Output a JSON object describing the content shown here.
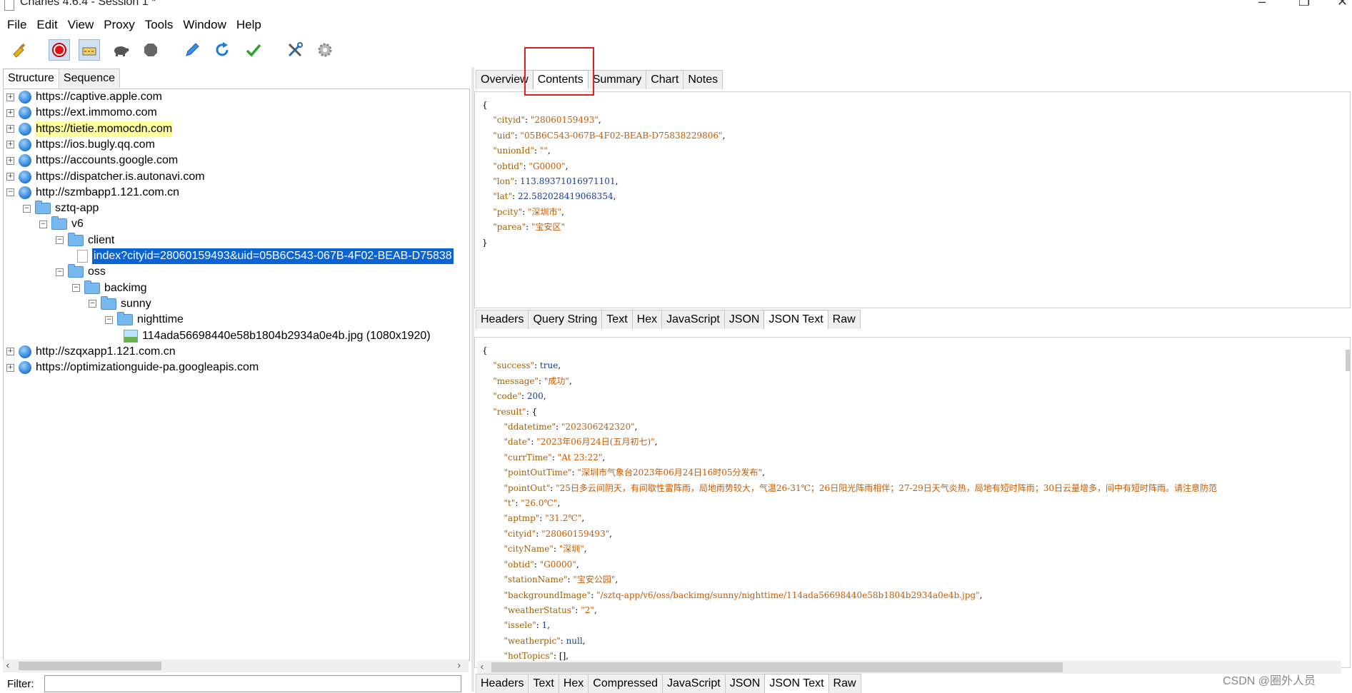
{
  "window": {
    "title": "Charles 4.6.4 - Session 1 *",
    "controls": [
      "–",
      "❐",
      "✕"
    ]
  },
  "menu": [
    "File",
    "Edit",
    "View",
    "Proxy",
    "Tools",
    "Window",
    "Help"
  ],
  "toolbar": {
    "icons": [
      "broom-icon",
      "record-icon",
      "throttle-icon",
      "turtle-icon",
      "stop-icon",
      "pen-icon",
      "refresh-icon",
      "check-icon",
      "tools-icon",
      "settings-icon"
    ]
  },
  "left": {
    "tabs": [
      "Structure",
      "Sequence"
    ],
    "active_tab": "Structure",
    "tree": [
      {
        "label": "https://captive.apple.com",
        "expander": "+"
      },
      {
        "label": "https://ext.immomo.com",
        "expander": "+"
      },
      {
        "label": "https://tietie.momocdn.com",
        "expander": "+"
      },
      {
        "label": "https://ios.bugly.qq.com",
        "expander": "+"
      },
      {
        "label": "https://accounts.google.com",
        "expander": "+"
      },
      {
        "label": "https://dispatcher.is.autonavi.com",
        "expander": "+"
      },
      {
        "label": "http://szmbapp1.121.com.cn",
        "expander": "−"
      },
      {
        "label": "sztq-app",
        "expander": "−"
      },
      {
        "label": "v6",
        "expander": "−"
      },
      {
        "label": "client",
        "expander": "−"
      },
      {
        "label": "index?cityid=28060159493&uid=05B6C543-067B-4F02-BEAB-D75838"
      },
      {
        "label": "oss",
        "expander": "−"
      },
      {
        "label": "backimg",
        "expander": "−"
      },
      {
        "label": "sunny",
        "expander": "−"
      },
      {
        "label": "nighttime",
        "expander": "−"
      },
      {
        "label": "114ada56698440e58b1804b2934a0e4b.jpg (1080x1920)"
      },
      {
        "label": "http://szqxapp1.121.com.cn",
        "expander": "+"
      },
      {
        "label": "https://optimizationguide-pa.googleapis.com",
        "expander": "+"
      }
    ],
    "filter_label": "Filter:",
    "filter_value": ""
  },
  "right": {
    "top_tabs": [
      "Overview",
      "Contents",
      "Summary",
      "Chart",
      "Notes"
    ],
    "active_top_tab": "Contents",
    "request_tabs": [
      "Headers",
      "Query String",
      "Text",
      "Hex",
      "JavaScript",
      "JSON",
      "JSON Text",
      "Raw"
    ],
    "active_request_tab": "JSON Text",
    "response_tabs": [
      "Headers",
      "Text",
      "Hex",
      "Compressed",
      "JavaScript",
      "JSON",
      "JSON Text",
      "Raw"
    ],
    "active_response_tab": "JSON Text",
    "request_lines": [
      [
        [
          "p",
          "{"
        ]
      ],
      [
        [
          "p",
          "    "
        ],
        [
          "k",
          "\"cityid\""
        ],
        [
          "p",
          ": "
        ],
        [
          "s",
          "\"28060159493\""
        ],
        [
          "p",
          ","
        ]
      ],
      [
        [
          "p",
          "    "
        ],
        [
          "k",
          "\"uid\""
        ],
        [
          "p",
          ": "
        ],
        [
          "s",
          "\"05B6C543-067B-4F02-BEAB-D75838229806\""
        ],
        [
          "p",
          ","
        ]
      ],
      [
        [
          "p",
          "    "
        ],
        [
          "k",
          "\"unionId\""
        ],
        [
          "p",
          ": "
        ],
        [
          "s",
          "\"\""
        ],
        [
          "p",
          ","
        ]
      ],
      [
        [
          "p",
          "    "
        ],
        [
          "k",
          "\"obtid\""
        ],
        [
          "p",
          ": "
        ],
        [
          "s",
          "\"G0000\""
        ],
        [
          "p",
          ","
        ]
      ],
      [
        [
          "p",
          "    "
        ],
        [
          "k",
          "\"lon\""
        ],
        [
          "p",
          ": "
        ],
        [
          "n",
          "113.89371016971101"
        ],
        [
          "p",
          ","
        ]
      ],
      [
        [
          "p",
          "    "
        ],
        [
          "k",
          "\"lat\""
        ],
        [
          "p",
          ": "
        ],
        [
          "n",
          "22.582028419068354"
        ],
        [
          "p",
          ","
        ]
      ],
      [
        [
          "p",
          "    "
        ],
        [
          "k",
          "\"pcity\""
        ],
        [
          "p",
          ": "
        ],
        [
          "s",
          "\"深圳市\""
        ],
        [
          "p",
          ","
        ]
      ],
      [
        [
          "p",
          "    "
        ],
        [
          "k",
          "\"parea\""
        ],
        [
          "p",
          ": "
        ],
        [
          "s",
          "\"宝安区\""
        ]
      ],
      [
        [
          "p",
          "}"
        ]
      ]
    ],
    "response_lines": [
      [
        [
          "p",
          "{"
        ]
      ],
      [
        [
          "p",
          "    "
        ],
        [
          "k",
          "\"success\""
        ],
        [
          "p",
          ": "
        ],
        [
          "kw",
          "true"
        ],
        [
          "p",
          ","
        ]
      ],
      [
        [
          "p",
          "    "
        ],
        [
          "k",
          "\"message\""
        ],
        [
          "p",
          ": "
        ],
        [
          "s",
          "\"成功\""
        ],
        [
          "p",
          ","
        ]
      ],
      [
        [
          "p",
          "    "
        ],
        [
          "k",
          "\"code\""
        ],
        [
          "p",
          ": "
        ],
        [
          "n",
          "200"
        ],
        [
          "p",
          ","
        ]
      ],
      [
        [
          "p",
          "    "
        ],
        [
          "k",
          "\"result\""
        ],
        [
          "p",
          ": {"
        ]
      ],
      [
        [
          "p",
          "        "
        ],
        [
          "k",
          "\"ddatetime\""
        ],
        [
          "p",
          ": "
        ],
        [
          "s",
          "\"202306242320\""
        ],
        [
          "p",
          ","
        ]
      ],
      [
        [
          "p",
          "        "
        ],
        [
          "k",
          "\"date\""
        ],
        [
          "p",
          ": "
        ],
        [
          "s",
          "\"2023年06月24日(五月初七)\""
        ],
        [
          "p",
          ","
        ]
      ],
      [
        [
          "p",
          "        "
        ],
        [
          "k",
          "\"currTime\""
        ],
        [
          "p",
          ": "
        ],
        [
          "s",
          "\"At 23:22\""
        ],
        [
          "p",
          ","
        ]
      ],
      [
        [
          "p",
          "        "
        ],
        [
          "k",
          "\"pointOutTime\""
        ],
        [
          "p",
          ": "
        ],
        [
          "s",
          "\"深圳市气象台2023年06月24日16时05分发布\""
        ],
        [
          "p",
          ","
        ]
      ],
      [
        [
          "p",
          "        "
        ],
        [
          "k",
          "\"pointOut\""
        ],
        [
          "p",
          ": "
        ],
        [
          "s",
          "\"25日多云间阴天，有间歇性雷阵雨，局地雨势较大，气温26-31℃；26日阳光阵雨相伴；27-29日天气炎热，局地有短时阵雨；30日云量增多，间中有短时阵雨。请注意防范"
        ]
      ],
      [
        [
          "p",
          "        "
        ],
        [
          "k",
          "\"t\""
        ],
        [
          "p",
          ": "
        ],
        [
          "s",
          "\"26.0℃\""
        ],
        [
          "p",
          ","
        ]
      ],
      [
        [
          "p",
          "        "
        ],
        [
          "k",
          "\"aptmp\""
        ],
        [
          "p",
          ": "
        ],
        [
          "s",
          "\"31.2℃\""
        ],
        [
          "p",
          ","
        ]
      ],
      [
        [
          "p",
          "        "
        ],
        [
          "k",
          "\"cityid\""
        ],
        [
          "p",
          ": "
        ],
        [
          "s",
          "\"28060159493\""
        ],
        [
          "p",
          ","
        ]
      ],
      [
        [
          "p",
          "        "
        ],
        [
          "k",
          "\"cityName\""
        ],
        [
          "p",
          ": "
        ],
        [
          "s",
          "\"深圳\""
        ],
        [
          "p",
          ","
        ]
      ],
      [
        [
          "p",
          "        "
        ],
        [
          "k",
          "\"obtid\""
        ],
        [
          "p",
          ": "
        ],
        [
          "s",
          "\"G0000\""
        ],
        [
          "p",
          ","
        ]
      ],
      [
        [
          "p",
          "        "
        ],
        [
          "k",
          "\"stationName\""
        ],
        [
          "p",
          ": "
        ],
        [
          "s",
          "\"宝安公园\""
        ],
        [
          "p",
          ","
        ]
      ],
      [
        [
          "p",
          "        "
        ],
        [
          "k",
          "\"backgroundImage\""
        ],
        [
          "p",
          ": "
        ],
        [
          "s",
          "\"/sztq-app/v6/oss/backimg/sunny/nighttime/114ada56698440e58b1804b2934a0e4b.jpg\""
        ],
        [
          "p",
          ","
        ]
      ],
      [
        [
          "p",
          "        "
        ],
        [
          "k",
          "\"weatherStatus\""
        ],
        [
          "p",
          ": "
        ],
        [
          "s",
          "\"2\""
        ],
        [
          "p",
          ","
        ]
      ],
      [
        [
          "p",
          "        "
        ],
        [
          "k",
          "\"issele\""
        ],
        [
          "p",
          ": "
        ],
        [
          "n",
          "1"
        ],
        [
          "p",
          ","
        ]
      ],
      [
        [
          "p",
          "        "
        ],
        [
          "k",
          "\"weatherpic\""
        ],
        [
          "p",
          ": "
        ],
        [
          "kw",
          "null"
        ],
        [
          "p",
          ","
        ]
      ],
      [
        [
          "p",
          "        "
        ],
        [
          "k",
          "\"hotTopics\""
        ],
        [
          "p",
          ": [],"
        ]
      ]
    ]
  },
  "watermark": "CSDN @圈外人员"
}
